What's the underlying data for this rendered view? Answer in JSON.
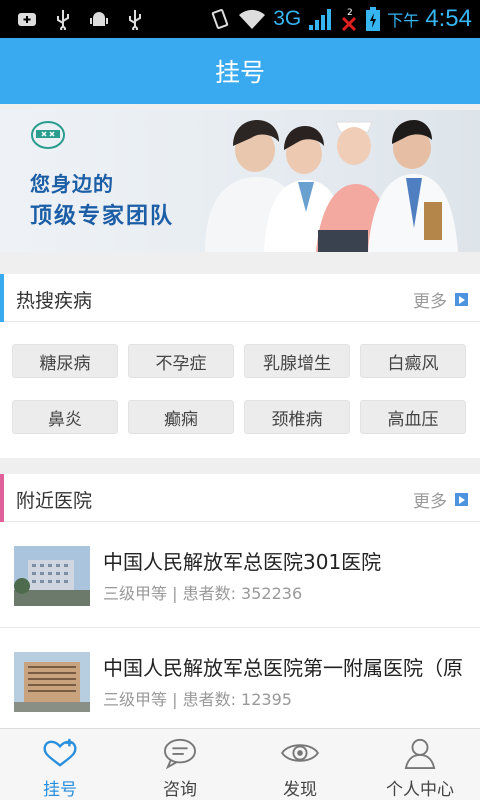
{
  "status_bar": {
    "network": "3G",
    "ampm": "下午",
    "time": "4:54",
    "accent_color": "#36b5f0"
  },
  "header": {
    "title": "挂号"
  },
  "banner": {
    "line1": "您身边的",
    "line2": "顶级专家团队"
  },
  "hot_diseases": {
    "title": "热搜疾病",
    "more_label": "更多",
    "accent_color": "#3aaaf0",
    "tags": [
      "糖尿病",
      "不孕症",
      "乳腺增生",
      "白癜风",
      "鼻炎",
      "癫痫",
      "颈椎病",
      "高血压"
    ]
  },
  "nearby_hospitals": {
    "title": "附近医院",
    "more_label": "更多",
    "accent_color": "#e0609a",
    "items": [
      {
        "name": "中国人民解放军总医院301医院",
        "meta": "三级甲等 | 患者数: 352236"
      },
      {
        "name": "中国人民解放军总医院第一附属医院（原",
        "meta": "三级甲等 | 患者数: 12395"
      }
    ]
  },
  "bottom_nav": {
    "active_color": "#2a8fdc",
    "items": [
      {
        "label": "挂号",
        "icon": "registration-icon"
      },
      {
        "label": "咨询",
        "icon": "chat-icon"
      },
      {
        "label": "发现",
        "icon": "eye-icon"
      },
      {
        "label": "个人中心",
        "icon": "person-icon"
      }
    ]
  }
}
